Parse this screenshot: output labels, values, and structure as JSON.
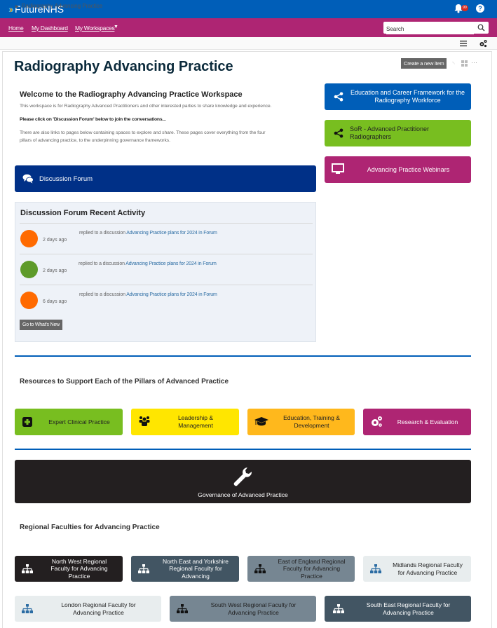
{
  "header": {
    "brand": "FutureNHS",
    "notification_count": "99",
    "help_label": "?"
  },
  "nav": {
    "items": [
      "Home",
      "My Dashboard",
      "My Workspaces"
    ],
    "search_placeholder": "Search"
  },
  "breadcrumb": {
    "current": "Radiography Advancing Practice"
  },
  "page": {
    "title": "Radiography Advancing Practice",
    "create_label": "Create a new item",
    "more_label": "···"
  },
  "welcome": {
    "heading": "Welcome to the Radiography Advancing Practice Workspace",
    "p1": "This workspace is for Radiography Advanced Practitioners and other interested parties to share knowledge and experience.",
    "p2": "Please click on 'Discussion Forum' below to join the conversations...",
    "p3a": "There are also links to pages below containing spaces to explore and share.  These pages cover everything from the four",
    "p3b": "pillars of advancing practice, to the underpinning governance frameworks."
  },
  "side_links": [
    {
      "label": "Education and Career Framework for the Radiography Workforce",
      "icon": "share-icon",
      "color": "#005eb8"
    },
    {
      "label": "SoR - Advanced Practitioner Radiographers",
      "icon": "share-icon",
      "color": "#78be20"
    },
    {
      "label": "Advancing Practice Webinars",
      "icon": "monitor-icon",
      "color": "#ae2573"
    }
  ],
  "forum": {
    "button_label": "Discussion Forum",
    "activity_title": "Discussion Forum Recent Activity",
    "items": [
      {
        "prefix": "replied to a discussion",
        "link": "Advancing Practice plans for 2024 in Forum",
        "ago": "2 days ago",
        "avatar_color": "#ff6a00"
      },
      {
        "prefix": "replied to a discussion",
        "link": "Advancing Practice plans for 2024 in Forum",
        "ago": "2 days ago",
        "avatar_color": "#5e9b2a"
      },
      {
        "prefix": "replied to a discussion",
        "link": "Advancing Practice plans for 2024 in Forum",
        "ago": "6 days ago",
        "avatar_color": "#ff6a00"
      }
    ],
    "whats_new_label": "Go to What's New"
  },
  "pillars": {
    "heading": "Resources to Support Each of the Pillars of Advanced Practice",
    "items": [
      {
        "label": "Expert Clinical Practice",
        "icon": "medical-cross-icon",
        "color": "#78be20"
      },
      {
        "label": "Leadership & Management",
        "icon": "users-icon",
        "color": "#ffe600"
      },
      {
        "label": "Education, Training & Development",
        "icon": "graduation-cap-icon",
        "color": "#ffb81c"
      },
      {
        "label": "Research & Evaluation",
        "icon": "gears-icon",
        "color": "#ae2573"
      }
    ]
  },
  "governance": {
    "label": "Governance of Advanced Practice",
    "color": "#231f20"
  },
  "regions": {
    "heading": "Regional Faculties for Advancing Practice",
    "items": [
      {
        "label": "North West Regional Faculty for Advancing Practice",
        "color": "#231f20"
      },
      {
        "label": "North East and Yorkshire Regional Faculty for Advancing",
        "color": "#425563"
      },
      {
        "label": "East of England Regional Faculty for Advancing Practice",
        "color": "#768692"
      },
      {
        "label": "Midlands Regional Faculty for Advancing Practice",
        "color": "#e8edee"
      },
      {
        "label": "London Regional Faculty for Advancing Practice",
        "color": "#e8edee"
      },
      {
        "label": "South West Regional Faculty for Advancing Practice",
        "color": "#768692"
      },
      {
        "label": "South East Regional Faculty for Advancing Practice",
        "color": "#425563"
      }
    ]
  }
}
